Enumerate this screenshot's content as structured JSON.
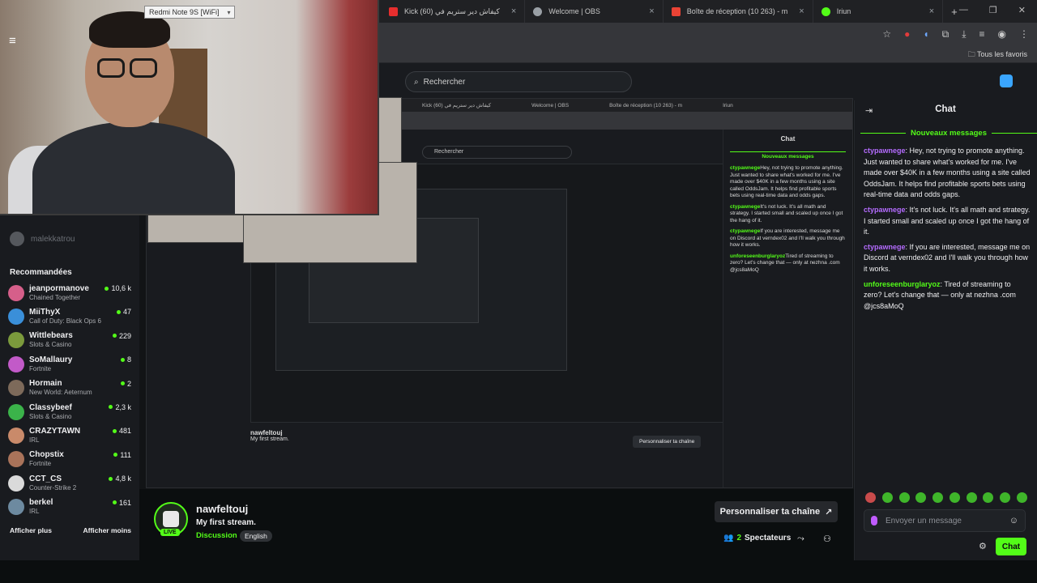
{
  "browser": {
    "tabs": [
      {
        "label": "Kick كيفاش دير ستريم في (60)",
        "favicon_color": "#e62e2e"
      },
      {
        "label": "Welcome | OBS",
        "favicon_color": "#9aa0a6"
      },
      {
        "label": "Boîte de réception (10 263) - m",
        "favicon_color": "#ea4335"
      },
      {
        "label": "Iriun",
        "favicon_color": "#53fc18"
      }
    ],
    "bookmarks_label": "Tous les favoris"
  },
  "webcam": {
    "device_label": "Redmi Note 9S [WiFi]"
  },
  "kick": {
    "search_placeholder": "Rechercher",
    "sidebar": {
      "following_user": "malekkatrou",
      "section_title": "Recommandées",
      "channels": [
        {
          "name": "jeanpormanove",
          "category": "Chained Together",
          "viewers": "10,6 k",
          "color": "#d65f8a"
        },
        {
          "name": "MiiThyX",
          "category": "Call of Duty: Black Ops 6",
          "viewers": "47",
          "color": "#3a8fd9"
        },
        {
          "name": "Wittlebears",
          "category": "Slots & Casino",
          "viewers": "229",
          "color": "#7b9a3c"
        },
        {
          "name": "SoMallaury",
          "category": "Fortnite",
          "viewers": "8",
          "color": "#c25ac8"
        },
        {
          "name": "Hormain",
          "category": "New World: Aeternum",
          "viewers": "2",
          "color": "#7d6a5a"
        },
        {
          "name": "Classybeef",
          "category": "Slots & Casino",
          "viewers": "2,3 k",
          "color": "#3bb34a"
        },
        {
          "name": "CRAZYTAWN",
          "category": "IRL",
          "viewers": "481",
          "color": "#c98a6a"
        },
        {
          "name": "Chopstix",
          "category": "Fortnite",
          "viewers": "111",
          "color": "#a9735a"
        },
        {
          "name": "CCT_CS",
          "category": "Counter-Strike 2",
          "viewers": "4,8 k",
          "color": "#dadada"
        },
        {
          "name": "berkel",
          "category": "IRL",
          "viewers": "161",
          "color": "#6d8aa0"
        }
      ],
      "show_more": "Afficher plus",
      "show_less": "Afficher moins"
    },
    "stream": {
      "channel": "nawfeltouj",
      "title": "My first stream.",
      "category": "Discussion",
      "language": "English",
      "live_badge": "LIVE",
      "customize_label": "Personnaliser ta chaîne",
      "viewer_count": "2",
      "viewer_label": "Spectateurs"
    },
    "chat": {
      "title": "Chat",
      "new_messages": "Nouveaux messages",
      "messages": [
        {
          "user": "ctypawnege",
          "text": "Hey, not trying to promote anything. Just wanted to share what's worked for me. I've made over $40K in a few months using a site called OddsJam. It helps find profitable sports bets using real-time data and odds gaps.",
          "color": "#b56cff"
        },
        {
          "user": "ctypawnege",
          "text": "It's not luck. It's all math and strategy. I started small and scaled up once I got the hang of it.",
          "color": "#b56cff"
        },
        {
          "user": "ctypawnege",
          "text": "If you are interested, message me on Discord at verndex02 and I'll walk you through how it works.",
          "color": "#b56cff"
        },
        {
          "user": "unforeseenburglaryoz",
          "text": "Tired of streaming to zero? Let's change that — only at nezhna .com @jcs8aMoQ",
          "color": "#53fc18"
        }
      ],
      "input_placeholder": "Envoyer un message",
      "send_label": "Chat"
    }
  },
  "capture": {
    "chat_title": "Chat",
    "new_messages": "Nouveaux messages",
    "search_placeholder": "Rechercher",
    "channel": "nawfeltouj",
    "title": "My first stream.",
    "customize_label": "Personnaliser ta chaîne"
  }
}
